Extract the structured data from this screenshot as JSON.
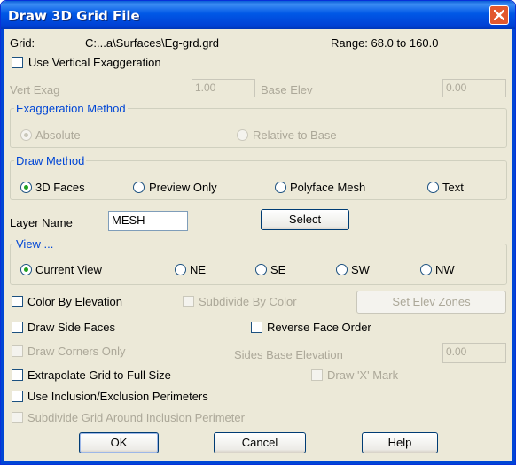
{
  "window": {
    "title": "Draw 3D Grid File"
  },
  "grid": {
    "label": "Grid:",
    "path": "C:...a\\Surfaces\\Eg-grd.grd",
    "range": "Range: 68.0 to 160.0"
  },
  "vertical_exaggeration": {
    "checkbox_label": "Use Vertical Exaggeration",
    "checked": false
  },
  "vert_exag": {
    "label": "Vert Exag",
    "value": "1.00"
  },
  "base_elev": {
    "label": "Base Elev",
    "value": "0.00"
  },
  "exaggeration_method": {
    "legend": "Exaggeration Method",
    "absolute": "Absolute",
    "relative": "Relative to Base",
    "selected": "absolute"
  },
  "draw_method": {
    "legend": "Draw Method",
    "options": [
      "3D Faces",
      "Preview Only",
      "Polyface Mesh",
      "Text"
    ],
    "selected": "3D Faces"
  },
  "layer": {
    "label": "Layer Name",
    "value": "MESH",
    "select_label": "Select"
  },
  "view": {
    "legend": "View ...",
    "options": [
      "Current View",
      "NE",
      "SE",
      "SW",
      "NW"
    ],
    "selected": "Current View"
  },
  "options": {
    "color_by_elevation": "Color By Elevation",
    "subdivide_by_color": "Subdivide By Color",
    "set_elev_zones": "Set Elev Zones",
    "draw_side_faces": "Draw Side Faces",
    "reverse_face_order": "Reverse Face Order",
    "draw_corners_only": "Draw Corners Only",
    "sides_base_elevation_label": "Sides Base Elevation",
    "sides_base_elevation_value": "0.00",
    "extrapolate_grid": "Extrapolate Grid to Full Size",
    "draw_x_mark": "Draw 'X' Mark",
    "use_perimeters": "Use Inclusion/Exclusion Perimeters",
    "subdivide_around_perimeter": "Subdivide Grid Around Inclusion Perimeter"
  },
  "buttons": {
    "ok": "OK",
    "cancel": "Cancel",
    "help": "Help"
  },
  "colors": {
    "title_bar": "#0058e6",
    "dialog_bg": "#ece9d8",
    "group_legend": "#0046d5",
    "radio_checked": "#21a121",
    "close_button": "#e2582e"
  }
}
